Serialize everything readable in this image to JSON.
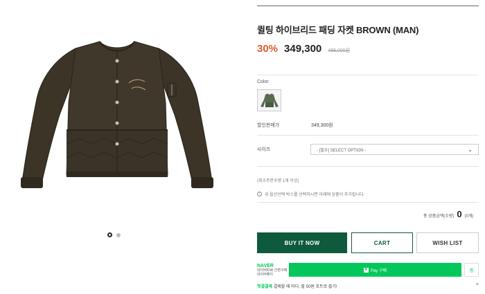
{
  "product": {
    "title": "퀼팅 하이브리드 패딩 자켓 BROWN (MAN)",
    "discount": "30%",
    "price": "349,300",
    "original_price": "499,000원",
    "image_icon": "jacket-photo",
    "slider_dots": 2,
    "slider_active_index": 0
  },
  "options": {
    "color_label": "Color",
    "color_swatch_icon": "jacket-swatch",
    "sale_price_label": "할인판매가",
    "sale_price_value": "349,300원",
    "size_label": "사이즈",
    "size_select_value": "- [필수] SELECT OPTION -",
    "min_order_note": "(최소주문수량 1개 이상)",
    "option_hint": "위 옵션선택 박스를 선택하시면 아래에 상품이 추가됩니다."
  },
  "total": {
    "label": "총 상품금액(수량)",
    "value": "0",
    "count": "(0개)"
  },
  "buttons": {
    "buy_now": "BUY IT NOW",
    "cart": "CART",
    "wish_list": "WISH LIST"
  },
  "npay": {
    "brand": "NAVER",
    "brand_sub1": "네이버ID로 간편구매",
    "brand_sub2": "네이버페이",
    "pay_label": "Pay 구매",
    "wish_label": "찜",
    "event_prefix": "첫결결제",
    "event_text": "결제할 때 마다, 할 50원 포트로 줍기!",
    "close": "×"
  },
  "colors": {
    "accent": "#0e5a3c",
    "discount": "#e0592a",
    "npay": "#03c75a",
    "jacket": "#3b3427"
  }
}
